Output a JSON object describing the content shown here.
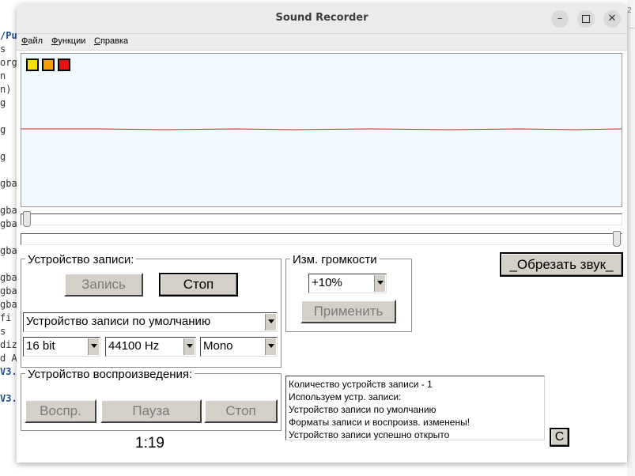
{
  "window": {
    "title": "Sound Recorder",
    "controls": [
      "minimize-icon",
      "maximize-icon",
      "close-icon"
    ]
  },
  "background_terminal": {
    "lines": [
      "/Pu",
      "s",
      "org",
      "n",
      " n)",
      "g",
      "",
      "g",
      "",
      "g",
      "",
      "gba",
      "",
      "gba",
      "gba",
      "",
      "gba",
      "",
      "gba",
      "gba",
      "gba",
      "  fi",
      "s",
      "diz",
      "d A",
      "V3.",
      "",
      "V3."
    ],
    "right_edge_text": "2"
  },
  "menu": [
    {
      "label": "Файл",
      "underline": "Ф",
      "rest": "айл"
    },
    {
      "label": "Функции",
      "underline": "Ф",
      "rest": "ункции"
    },
    {
      "label": "Справка",
      "underline": "С",
      "rest": "правка"
    }
  ],
  "wave": {
    "indicators": [
      "#f5e000",
      "#f5a000",
      "#e81010"
    ],
    "line_color": "#cc2222",
    "background": "#f0f9fd"
  },
  "record_group": {
    "label": "Устройство записи:",
    "record_button": "Запись",
    "stop_button": "Стоп",
    "device": "Устройство записи по умолчанию",
    "bits": "16 bit",
    "rate": "44100 Hz",
    "channels": "Mono"
  },
  "volume_group": {
    "label": "Изм. громкости",
    "value": "+10%",
    "apply_button": "Применить"
  },
  "trim_button": "_Обрезать звук_",
  "playback_group": {
    "label": "Устройство воспроизведения:",
    "play_button": "Воспр.",
    "pause_button": "Пауза",
    "stop_button": "Стоп"
  },
  "time": "1:19",
  "log": [
    "Количество устройств записи - 1",
    "Используем устр. записи:",
    "Устройство записи по умолчанию",
    "Форматы записи и воспроизв. изменены!",
    "Устройство записи успешно открыто"
  ],
  "clear_button": "C"
}
